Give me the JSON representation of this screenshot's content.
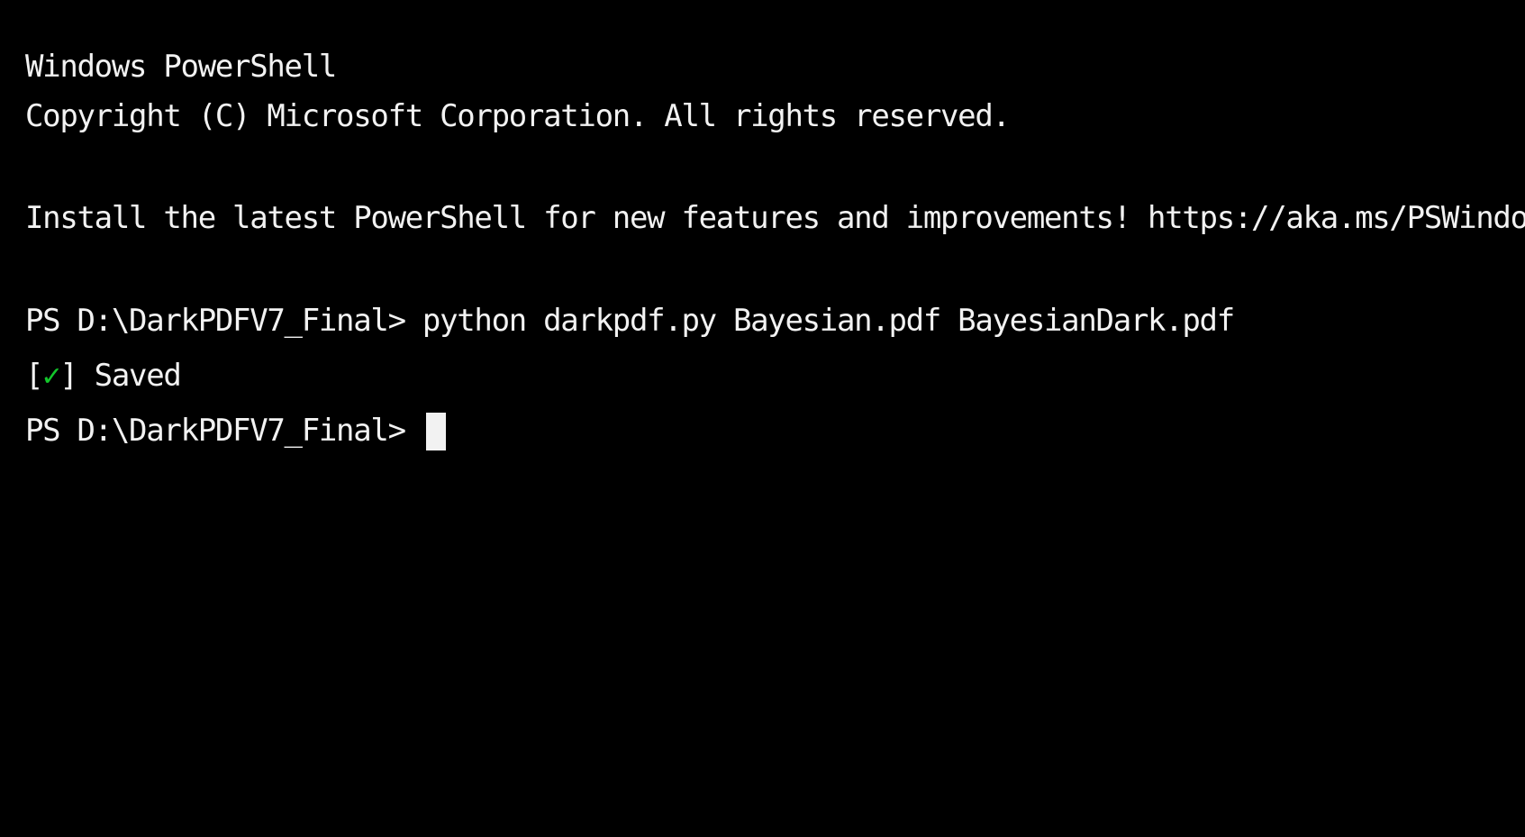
{
  "terminal": {
    "header_title": "Windows PowerShell",
    "copyright": "Copyright (C) Microsoft Corporation. All rights reserved.",
    "install_notice": "Install the latest PowerShell for new features and improvements! https://aka.ms/PSWindows",
    "prompt": "PS D:\\DarkPDFV7_Final> ",
    "command": "python darkpdf.py Bayesian.pdf BayesianDark.pdf",
    "result": {
      "open_bracket": "[",
      "check_glyph": "✓",
      "close_bracket": "]",
      "message": " Saved"
    },
    "colors": {
      "background": "#000000",
      "foreground": "#f2f2f2",
      "success": "#13c62b"
    }
  }
}
